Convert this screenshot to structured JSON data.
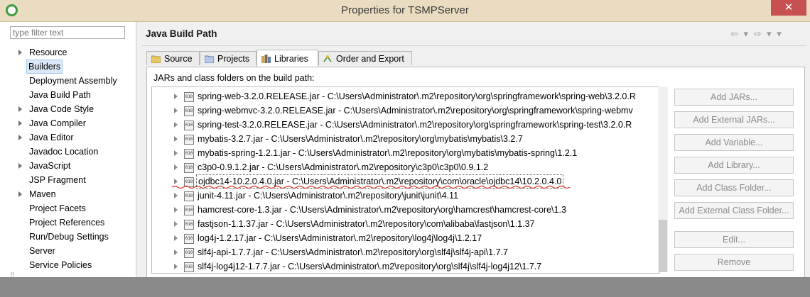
{
  "window": {
    "title": "Properties for TSMPServer",
    "close_glyph": "✕"
  },
  "filter": {
    "placeholder": "type filter text"
  },
  "nav": {
    "items": [
      {
        "label": "Resource",
        "expandable": true
      },
      {
        "label": "Builders",
        "expandable": false,
        "selected": true
      },
      {
        "label": "Deployment Assembly",
        "expandable": false
      },
      {
        "label": "Java Build Path",
        "expandable": false,
        "current": true
      },
      {
        "label": "Java Code Style",
        "expandable": true
      },
      {
        "label": "Java Compiler",
        "expandable": true
      },
      {
        "label": "Java Editor",
        "expandable": true
      },
      {
        "label": "Javadoc Location",
        "expandable": false
      },
      {
        "label": "JavaScript",
        "expandable": true
      },
      {
        "label": "JSP Fragment",
        "expandable": false
      },
      {
        "label": "Maven",
        "expandable": true
      },
      {
        "label": "Project Facets",
        "expandable": false
      },
      {
        "label": "Project References",
        "expandable": false
      },
      {
        "label": "Run/Debug Settings",
        "expandable": false
      },
      {
        "label": "Server",
        "expandable": false
      },
      {
        "label": "Service Policies",
        "expandable": false
      }
    ]
  },
  "header": {
    "title": "Java Build Path",
    "nav_glyphs": "⇦ ▾ ⇨ ▾ ▾"
  },
  "tabs": [
    {
      "label": "Source",
      "icon": "source-folder-icon"
    },
    {
      "label": "Projects",
      "icon": "projects-icon"
    },
    {
      "label": "Libraries",
      "icon": "libraries-icon",
      "active": true
    },
    {
      "label": "Order and Export",
      "icon": "order-export-icon"
    }
  ],
  "panel": {
    "caption": "JARs and class folders on the build path:"
  },
  "libraries": [
    "spring-web-3.2.0.RELEASE.jar - C:\\Users\\Administrator\\.m2\\repository\\org\\springframework\\spring-web\\3.2.0.R",
    "spring-webmvc-3.2.0.RELEASE.jar - C:\\Users\\Administrator\\.m2\\repository\\org\\springframework\\spring-webmv",
    "spring-test-3.2.0.RELEASE.jar - C:\\Users\\Administrator\\.m2\\repository\\org\\springframework\\spring-test\\3.2.0.R",
    "mybatis-3.2.7.jar - C:\\Users\\Administrator\\.m2\\repository\\org\\mybatis\\mybatis\\3.2.7",
    "mybatis-spring-1.2.1.jar - C:\\Users\\Administrator\\.m2\\repository\\org\\mybatis\\mybatis-spring\\1.2.1",
    "c3p0-0.9.1.2.jar - C:\\Users\\Administrator\\.m2\\repository\\c3p0\\c3p0\\0.9.1.2",
    "ojdbc14-10.2.0.4.0.jar - C:\\Users\\Administrator\\.m2\\repository\\com\\oracle\\ojdbc14\\10.2.0.4.0",
    "junit-4.11.jar - C:\\Users\\Administrator\\.m2\\repository\\junit\\junit\\4.11",
    "hamcrest-core-1.3.jar - C:\\Users\\Administrator\\.m2\\repository\\org\\hamcrest\\hamcrest-core\\1.3",
    "fastjson-1.1.37.jar - C:\\Users\\Administrator\\.m2\\repository\\com\\alibaba\\fastjson\\1.1.37",
    "log4j-1.2.17.jar - C:\\Users\\Administrator\\.m2\\repository\\log4j\\log4j\\1.2.17",
    "slf4j-api-1.7.7.jar - C:\\Users\\Administrator\\.m2\\repository\\org\\slf4j\\slf4j-api\\1.7.7",
    "slf4j-log4j12-1.7.7.jar - C:\\Users\\Administrator\\.m2\\repository\\org\\slf4j\\slf4j-log4j12\\1.7.7"
  ],
  "selected_library_index": 6,
  "buttons": {
    "add_jars": "Add JARs...",
    "add_external_jars": "Add External JARs...",
    "add_variable": "Add Variable...",
    "add_library": "Add Library...",
    "add_class_folder": "Add Class Folder...",
    "add_external_class_folder": "Add External Class Folder...",
    "edit": "Edit...",
    "remove": "Remove"
  },
  "colors": {
    "titlebar": "#e9dcc0",
    "close": "#c75050",
    "annotation": "#d4322c",
    "selection": "#dbe8f7"
  }
}
